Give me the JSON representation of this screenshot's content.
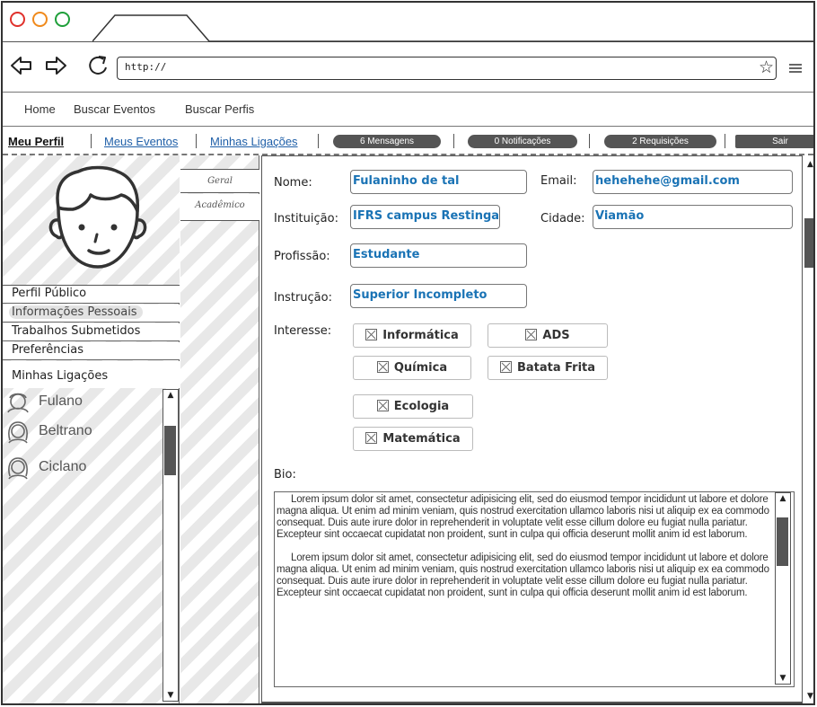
{
  "browser": {
    "url": "http://"
  },
  "topnav": {
    "items": [
      "Home",
      "Buscar Eventos",
      "Buscar Perfis"
    ]
  },
  "subnav": {
    "links": [
      "Meu Perfil",
      "Meus Eventos",
      "Minhas Ligações"
    ],
    "badges": [
      "6 Mensagens",
      "0 Notificações",
      "2 Requisições"
    ],
    "logout": "Sair"
  },
  "sidebar": {
    "menu": [
      "Perfil Público",
      "Informações Pessoais",
      "Trabalhos Submetidos",
      "Preferências"
    ],
    "connections_title": "Minhas Ligações",
    "connections": [
      "Fulano",
      "Beltrano",
      "Ciclano"
    ]
  },
  "side_tabs": [
    "Geral",
    "Acadêmico"
  ],
  "form": {
    "nome_label": "Nome:",
    "nome": "Fulaninho de tal",
    "email_label": "Email:",
    "email": "hehehehe@gmail.com",
    "instituicao_label": "Instituição:",
    "instituicao": "IFRS campus Restinga",
    "cidade_label": "Cidade:",
    "cidade": "Viamão",
    "profissao_label": "Profissão:",
    "profissao": "Estudante",
    "instrucao_label": "Instrução:",
    "instrucao": "Superior Incompleto",
    "interesse_label": "Interesse:",
    "interests": [
      "Informática",
      "ADS",
      "Química",
      "Batata Frita",
      "Ecologia",
      "Matemática"
    ],
    "bio_label": "Bio:",
    "bio_paragraphs": [
      "Lorem ipsum dolor sit amet, consectetur adipisicing elit, sed do eiusmod tempor incididunt ut labore et dolore magna aliqua. Ut enim ad minim veniam, quis nostrud exercitation ullamco laboris nisi ut aliquip ex ea commodo consequat. Duis aute irure dolor in reprehenderit in voluptate velit esse cillum dolore eu fugiat nulla pariatur. Excepteur sint occaecat cupidatat non proident, sunt in culpa qui officia deserunt mollit anim id est laborum.",
      "Lorem ipsum dolor sit amet, consectetur adipisicing elit, sed do eiusmod tempor incididunt ut labore et dolore magna aliqua. Ut enim ad minim veniam, quis nostrud exercitation ullamco laboris nisi ut aliquip ex ea commodo consequat. Duis aute irure dolor in reprehenderit in voluptate velit esse cillum dolore eu fugiat nulla pariatur. Excepteur sint occaecat cupidatat non proident, sunt in culpa qui officia deserunt mollit anim id est laborum."
    ]
  },
  "colors": {
    "field_value": "#1a73b5",
    "link": "#1f5fa8",
    "badge": "#555555"
  }
}
